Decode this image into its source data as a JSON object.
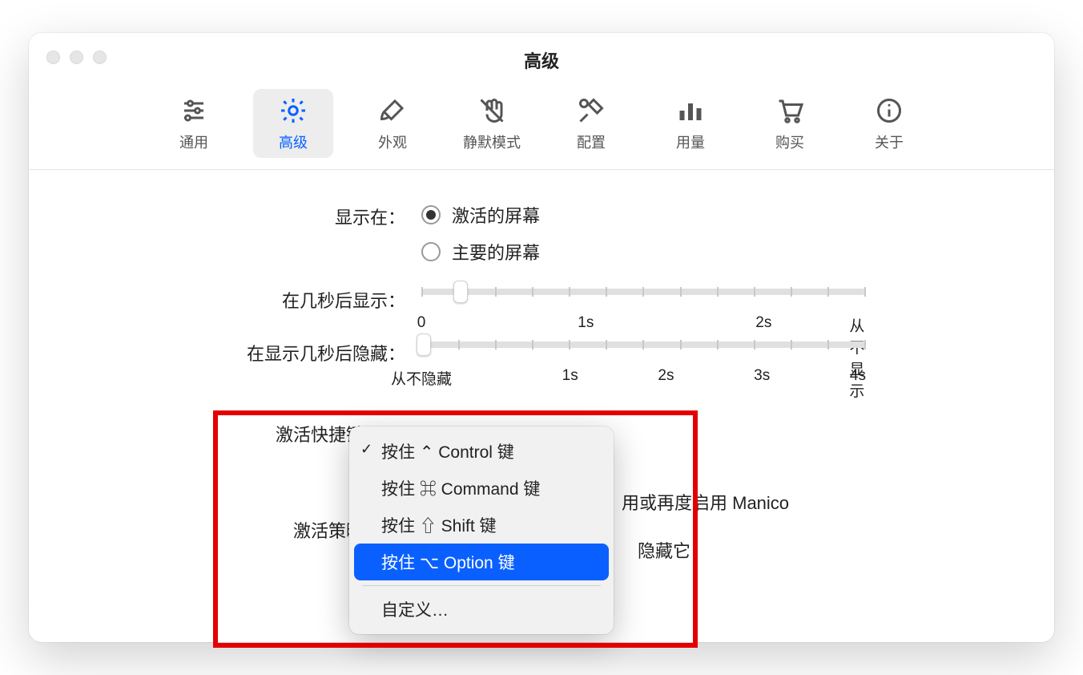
{
  "window": {
    "title": "高级"
  },
  "toolbar": {
    "items": [
      {
        "label": "通用"
      },
      {
        "label": "高级"
      },
      {
        "label": "外观"
      },
      {
        "label": "静默模式"
      },
      {
        "label": "配置"
      },
      {
        "label": "用量"
      },
      {
        "label": "购买"
      },
      {
        "label": "关于"
      }
    ]
  },
  "form": {
    "display_on": {
      "label": "显示在：",
      "option_active": "激活的屏幕",
      "option_main": "主要的屏幕"
    },
    "show_after": {
      "label": "在几秒后显示：",
      "ticks": {
        "t0": "0",
        "t1": "1s",
        "t2": "2s",
        "t3": "从不显示"
      }
    },
    "hide_after": {
      "label": "在显示几秒后隐藏：",
      "ticks": {
        "t0": "从不隐藏",
        "t1": "1s",
        "t2": "2s",
        "t3": "3s",
        "t4": "4s"
      }
    },
    "hotkey": {
      "label": "激活快捷键："
    },
    "strategy": {
      "label": "激活策略："
    },
    "partial1": "用或再度启用 Manico",
    "partial2": "隐藏它"
  },
  "menu": {
    "control": "按住 ⌃ Control 键",
    "command": "按住 ⌘ Command 键",
    "shift": "按住 ⇧ Shift 键",
    "option": "按住 ⌥ Option 键",
    "custom": "自定义…"
  }
}
